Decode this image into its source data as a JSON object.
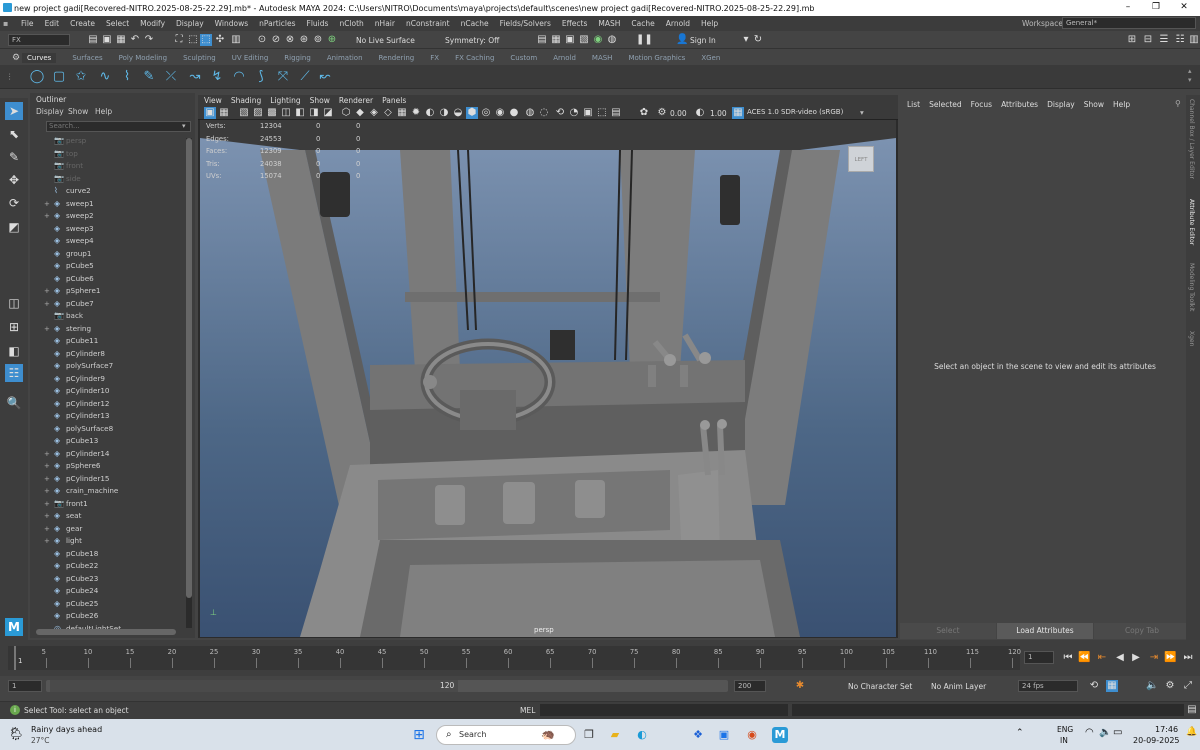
{
  "window": {
    "title": "new project gadi[Recovered-NITRO.2025-08-25-22.29].mb* - Autodesk MAYA 2024: C:\\Users\\NITRO\\Documents\\maya\\projects\\default\\scenes\\new project gadi[Recovered-NITRO.2025-08-25-22.29].mb",
    "controls": [
      "–",
      "❐",
      "✕"
    ]
  },
  "menubar": {
    "items": [
      "File",
      "Edit",
      "Create",
      "Select",
      "Modify",
      "Display",
      "Windows",
      "nParticles",
      "Fluids",
      "nCloth",
      "nHair",
      "nConstraint",
      "nCache",
      "Fields/Solvers",
      "Effects",
      "MASH",
      "Cache",
      "Arnold",
      "Help"
    ],
    "workspace_label": "Workspace:",
    "workspace_value": "General*"
  },
  "statusline": {
    "menuset": "FX",
    "live_surface": "No Live Surface",
    "symmetry": "Symmetry: Off",
    "sign_in": "Sign In"
  },
  "shelf": {
    "tabs": [
      "Curves",
      "Surfaces",
      "Poly Modeling",
      "Sculpting",
      "UV Editing",
      "Rigging",
      "Animation",
      "Rendering",
      "FX",
      "FX Caching",
      "Custom",
      "Arnold",
      "MASH",
      "Motion Graphics",
      "XGen"
    ],
    "active_tab": "Curves",
    "icons": [
      "circle-icon",
      "square-icon",
      "star-icon",
      "curve-cv-icon",
      "curve-ep-icon",
      "pencil-curve-icon",
      "bezier-icon",
      "arc-icon",
      "arc2-icon",
      "loft-icon",
      "offset-icon",
      "curve-tool-icon"
    ]
  },
  "outliner": {
    "title": "Outliner",
    "menu": [
      "Display",
      "Show",
      "Help"
    ],
    "search_placeholder": "Search...",
    "items": [
      {
        "label": "persp",
        "exp": "",
        "icon": "📷",
        "dim": true
      },
      {
        "label": "top",
        "exp": "",
        "icon": "📷",
        "dim": true
      },
      {
        "label": "front",
        "exp": "",
        "icon": "📷",
        "dim": true
      },
      {
        "label": "side",
        "exp": "",
        "icon": "📷",
        "dim": true
      },
      {
        "label": "curve2",
        "exp": "",
        "icon": "⌇",
        "dim": false
      },
      {
        "label": "sweep1",
        "exp": "+",
        "icon": "◈",
        "dim": false
      },
      {
        "label": "sweep2",
        "exp": "+",
        "icon": "◈",
        "dim": false
      },
      {
        "label": "sweep3",
        "exp": "",
        "icon": "◈",
        "dim": false
      },
      {
        "label": "sweep4",
        "exp": "",
        "icon": "◈",
        "dim": false
      },
      {
        "label": "group1",
        "exp": "",
        "icon": "◈",
        "dim": false
      },
      {
        "label": "pCube5",
        "exp": "",
        "icon": "◈",
        "dim": false
      },
      {
        "label": "pCube6",
        "exp": "",
        "icon": "◈",
        "dim": false
      },
      {
        "label": "pSphere1",
        "exp": "+",
        "icon": "◈",
        "dim": false
      },
      {
        "label": "pCube7",
        "exp": "+",
        "icon": "◈",
        "dim": false
      },
      {
        "label": "back",
        "exp": "",
        "icon": "📷",
        "dim": false
      },
      {
        "label": "stering",
        "exp": "+",
        "icon": "◈",
        "dim": false
      },
      {
        "label": "pCube11",
        "exp": "",
        "icon": "◈",
        "dim": false
      },
      {
        "label": "pCylinder8",
        "exp": "",
        "icon": "◈",
        "dim": false
      },
      {
        "label": "polySurface7",
        "exp": "",
        "icon": "◈",
        "dim": false
      },
      {
        "label": "pCylinder9",
        "exp": "",
        "icon": "◈",
        "dim": false
      },
      {
        "label": "pCylinder10",
        "exp": "",
        "icon": "◈",
        "dim": false
      },
      {
        "label": "pCylinder12",
        "exp": "",
        "icon": "◈",
        "dim": false
      },
      {
        "label": "pCylinder13",
        "exp": "",
        "icon": "◈",
        "dim": false
      },
      {
        "label": "polySurface8",
        "exp": "",
        "icon": "◈",
        "dim": false
      },
      {
        "label": "pCube13",
        "exp": "",
        "icon": "◈",
        "dim": false
      },
      {
        "label": "pCylinder14",
        "exp": "+",
        "icon": "◈",
        "dim": false
      },
      {
        "label": "pSphere6",
        "exp": "+",
        "icon": "◈",
        "dim": false
      },
      {
        "label": "pCylinder15",
        "exp": "+",
        "icon": "◈",
        "dim": false
      },
      {
        "label": "crain_machine",
        "exp": "+",
        "icon": "◈",
        "dim": false
      },
      {
        "label": "front1",
        "exp": "+",
        "icon": "📷",
        "dim": false
      },
      {
        "label": "seat",
        "exp": "+",
        "icon": "◈",
        "dim": false
      },
      {
        "label": "gear",
        "exp": "+",
        "icon": "◈",
        "dim": false
      },
      {
        "label": "light",
        "exp": "+",
        "icon": "◈",
        "dim": false
      },
      {
        "label": "pCube18",
        "exp": "",
        "icon": "◈",
        "dim": false
      },
      {
        "label": "pCube22",
        "exp": "",
        "icon": "◈",
        "dim": false
      },
      {
        "label": "pCube23",
        "exp": "",
        "icon": "◈",
        "dim": false
      },
      {
        "label": "pCube24",
        "exp": "",
        "icon": "◈",
        "dim": false
      },
      {
        "label": "pCube25",
        "exp": "",
        "icon": "◈",
        "dim": false
      },
      {
        "label": "pCube26",
        "exp": "",
        "icon": "◈",
        "dim": false
      },
      {
        "label": "defaultLightSet",
        "exp": "",
        "icon": "◎",
        "dim": false
      }
    ]
  },
  "viewport": {
    "menu": [
      "View",
      "Shading",
      "Lighting",
      "Show",
      "Renderer",
      "Panels"
    ],
    "exposure": "0.00",
    "gamma": "1.00",
    "colorspace": "ACES 1.0 SDR-video (sRGB)",
    "camera_label": "persp",
    "view_cube": "LEFT",
    "hud": [
      {
        "label": "Verts:",
        "value": "12304",
        "a": "0",
        "b": "0"
      },
      {
        "label": "Edges:",
        "value": "24553",
        "a": "0",
        "b": "0"
      },
      {
        "label": "Faces:",
        "value": "12309",
        "a": "0",
        "b": "0"
      },
      {
        "label": "Tris:",
        "value": "24038",
        "a": "0",
        "b": "0"
      },
      {
        "label": "UVs:",
        "value": "15074",
        "a": "0",
        "b": "0"
      }
    ]
  },
  "attribute_editor": {
    "menu": [
      "List",
      "Selected",
      "Focus",
      "Attributes",
      "Display",
      "Show",
      "Help"
    ],
    "message": "Select an object in the scene to view and edit its attributes",
    "buttons": [
      "Select",
      "Load Attributes",
      "Copy Tab"
    ],
    "side_tabs": [
      "Channel Box / Layer Editor",
      "Attribute Editor",
      "Modeling Toolkit",
      "Xgen"
    ]
  },
  "timeline": {
    "ticks": [
      "5",
      "10",
      "15",
      "20",
      "25",
      "30",
      "35",
      "40",
      "45",
      "50",
      "55",
      "60",
      "65",
      "70",
      "75",
      "80",
      "85",
      "90",
      "95",
      "100",
      "105",
      "110",
      "115",
      "120"
    ],
    "start_label": "1",
    "current_frame": "1",
    "range_start": "1",
    "range_inner_start": "1",
    "range_inner_end": "120",
    "range_end": "200",
    "character_set": "No Character Set",
    "anim_layer": "No Anim Layer",
    "fps": "24 fps"
  },
  "commandline": {
    "help_text": "Select Tool: select an object",
    "lang": "MEL"
  },
  "taskbar": {
    "weather_title": "Rainy days ahead",
    "weather_temp": "27°C",
    "search": "Search",
    "lang1": "ENG",
    "lang2": "IN",
    "time": "17:46",
    "date": "20-09-2025"
  },
  "colors": {
    "accent_blue": "#5fb9e8",
    "panel_bg": "#444444",
    "viewport_sky": "#4d6786",
    "active_tool": "#3e8ecf"
  }
}
